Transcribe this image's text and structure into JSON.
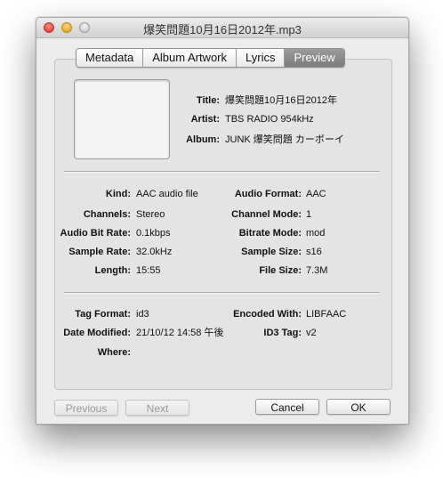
{
  "window": {
    "title": "爆笑問題10月16日2012年.mp3"
  },
  "tabs": [
    {
      "label": "Metadata",
      "active": false
    },
    {
      "label": "Album Artwork",
      "active": false
    },
    {
      "label": "Lyrics",
      "active": false
    },
    {
      "label": "Preview",
      "active": true
    }
  ],
  "track": {
    "title_label": "Title:",
    "title": "爆笑問題10月16日2012年",
    "artist_label": "Artist:",
    "artist": "TBS RADIO 954kHz",
    "album_label": "Album:",
    "album": "JUNK 爆笑問題 カーボーイ"
  },
  "audio": {
    "kind_label": "Kind:",
    "kind": "AAC audio file",
    "format_label": "Audio Format:",
    "format": "AAC",
    "channels_label": "Channels:",
    "channels": "Stereo",
    "channel_mode_label": "Channel Mode:",
    "channel_mode": "1",
    "bitrate_label": "Audio Bit Rate:",
    "bitrate": "0.1kbps",
    "bitrate_mode_label": "Bitrate Mode:",
    "bitrate_mode": "mod",
    "sample_rate_label": "Sample Rate:",
    "sample_rate": "32.0kHz",
    "sample_size_label": "Sample Size:",
    "sample_size": "s16",
    "length_label": "Length:",
    "length": "15:55",
    "file_size_label": "File Size:",
    "file_size": "7.3M"
  },
  "tag": {
    "format_label": "Tag Format:",
    "format": "id3",
    "encoded_label": "Encoded With:",
    "encoded": "LIBFAAC",
    "modified_label": "Date Modified:",
    "modified": "21/10/12 14:58 午後",
    "id3_label": "ID3 Tag:",
    "id3": "v2",
    "where_label": "Where:",
    "where": ""
  },
  "buttons": {
    "previous": "Previous",
    "next": "Next",
    "cancel": "Cancel",
    "ok": "OK"
  }
}
